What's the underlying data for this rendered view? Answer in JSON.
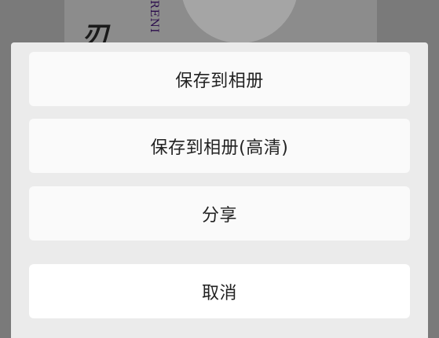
{
  "background": {
    "vertical_text": "RENI"
  },
  "action_sheet": {
    "options": [
      {
        "label": "保存到相册"
      },
      {
        "label": "保存到相册(高清)"
      },
      {
        "label": "分享"
      }
    ],
    "cancel_label": "取消"
  },
  "colors": {
    "overlay": "#7a7a7a",
    "sheet_background": "#ebebeb",
    "button_background": "#fafafa",
    "text": "#222222"
  }
}
